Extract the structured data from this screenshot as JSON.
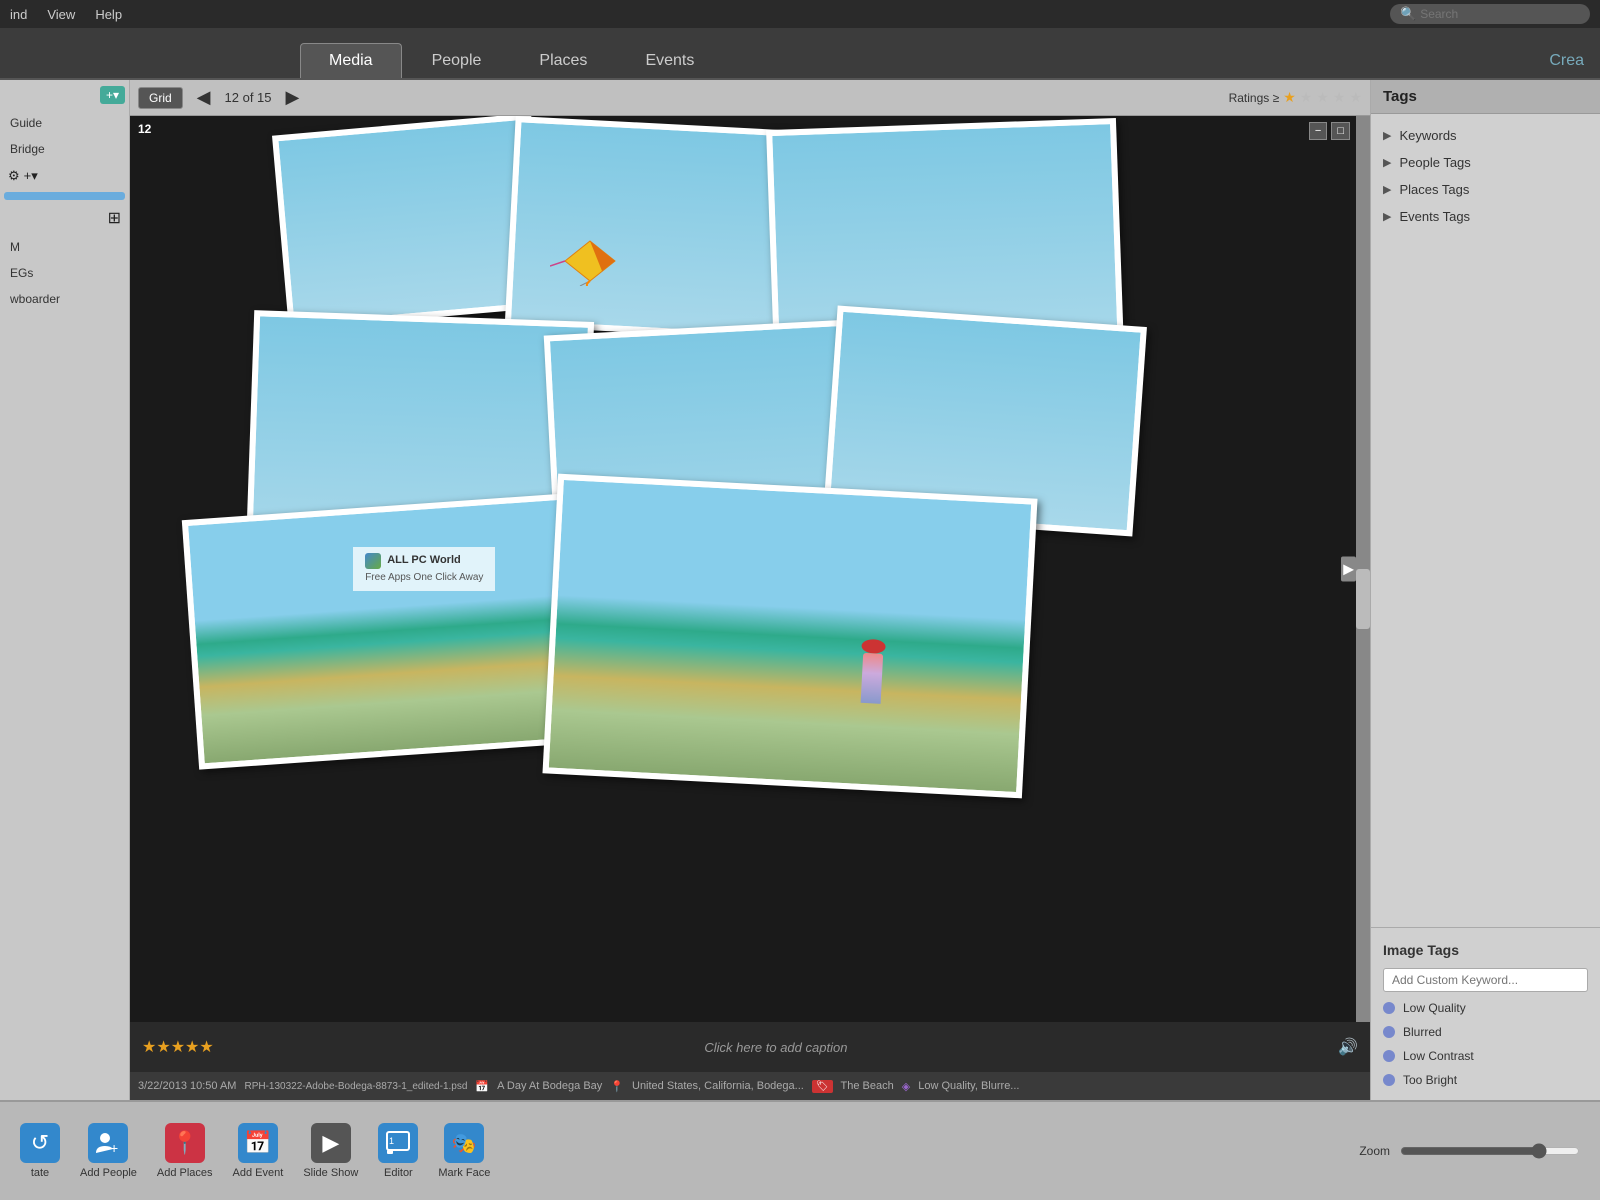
{
  "menubar": {
    "find_label": "ind",
    "view_label": "View",
    "help_label": "Help",
    "search_placeholder": "Search"
  },
  "nav": {
    "tabs": [
      {
        "id": "media",
        "label": "Media",
        "active": true
      },
      {
        "id": "people",
        "label": "People",
        "active": false
      },
      {
        "id": "places",
        "label": "Places",
        "active": false
      },
      {
        "id": "events",
        "label": "Events",
        "active": false
      }
    ],
    "create_label": "Crea"
  },
  "toolbar": {
    "grid_label": "Grid",
    "prev_arrow": "◀",
    "next_arrow": "▶",
    "page_info": "12 of 15",
    "ratings_label": "Ratings ≥",
    "stars": [
      "★",
      "★",
      "★",
      "★",
      "★"
    ]
  },
  "photo": {
    "number": "12",
    "caption_placeholder": "Click here to add caption",
    "rating_stars": "★★★★★",
    "date_time": "3/22/2013 10:50 AM",
    "filename": "RPH-130322-Adobe-Bodega-8873-1_edited-1.psd",
    "location": "A Day At Bodega Bay",
    "place": "United States, California, Bodega...",
    "tags": "The Beach",
    "quality": "Low Quality, Blurre...",
    "sound_icon": "🔊"
  },
  "watermark": {
    "line1": "ALL PC World",
    "line2": "Free Apps One Click Away"
  },
  "sidebar_left": {
    "add_btn": "+▾",
    "guide_label": "Guide",
    "bridge_label": "Bridge",
    "settings_icon": "⚙",
    "add_icon": "+▾",
    "connect_icon": "⊞",
    "m_label": "M",
    "egs_label": "EGs",
    "wboarder_label": "wboarder"
  },
  "tags_panel": {
    "title": "Tags",
    "items": [
      {
        "label": "Keywords"
      },
      {
        "label": "People Tags"
      },
      {
        "label": "Places Tags"
      },
      {
        "label": "Events Tags"
      }
    ],
    "expand_icon": "▶"
  },
  "image_tags": {
    "title": "Image Tags",
    "placeholder": "Add Custom Keyword...",
    "tags": [
      {
        "label": "Low Quality"
      },
      {
        "label": "Blurred"
      },
      {
        "label": "Low Contrast"
      },
      {
        "label": "Too Bright"
      }
    ]
  },
  "bottom_toolbar": {
    "rotate_label": "tate",
    "add_people_label": "Add People",
    "add_places_label": "Add Places",
    "add_event_label": "Add Event",
    "slide_show_label": "Slide Show",
    "editor_label": "Editor",
    "mark_face_label": "Mark Face",
    "zoom_label": "Zoom"
  }
}
